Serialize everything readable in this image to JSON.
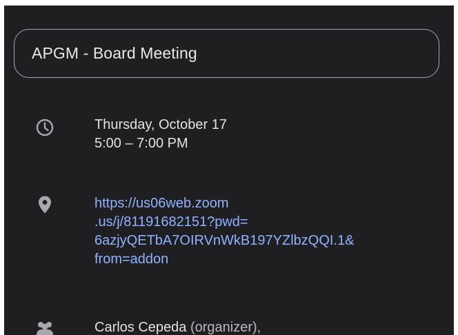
{
  "event": {
    "title": "APGM - Board Meeting",
    "date": "Thursday, October 17",
    "time": "5:00 – 7:00 PM",
    "location_lines": [
      "https://us06web.zoom",
      ".us/j/81191682151?pwd=",
      "6azjyQETbA7OIRVnWkB197YZlbzQQI.1&",
      "from=addon"
    ],
    "organizer_name": "Carlos Cepeda",
    "organizer_suffix": " (organizer),"
  },
  "icons": {
    "time": "clock-icon",
    "location": "location-pin-icon",
    "guests": "people-icon"
  },
  "colors": {
    "background": "#1f1f21",
    "text": "#e3e3e6",
    "link": "#8fb3ff",
    "icon": "#a8a8ae",
    "field_border": "#9ea6c2"
  }
}
